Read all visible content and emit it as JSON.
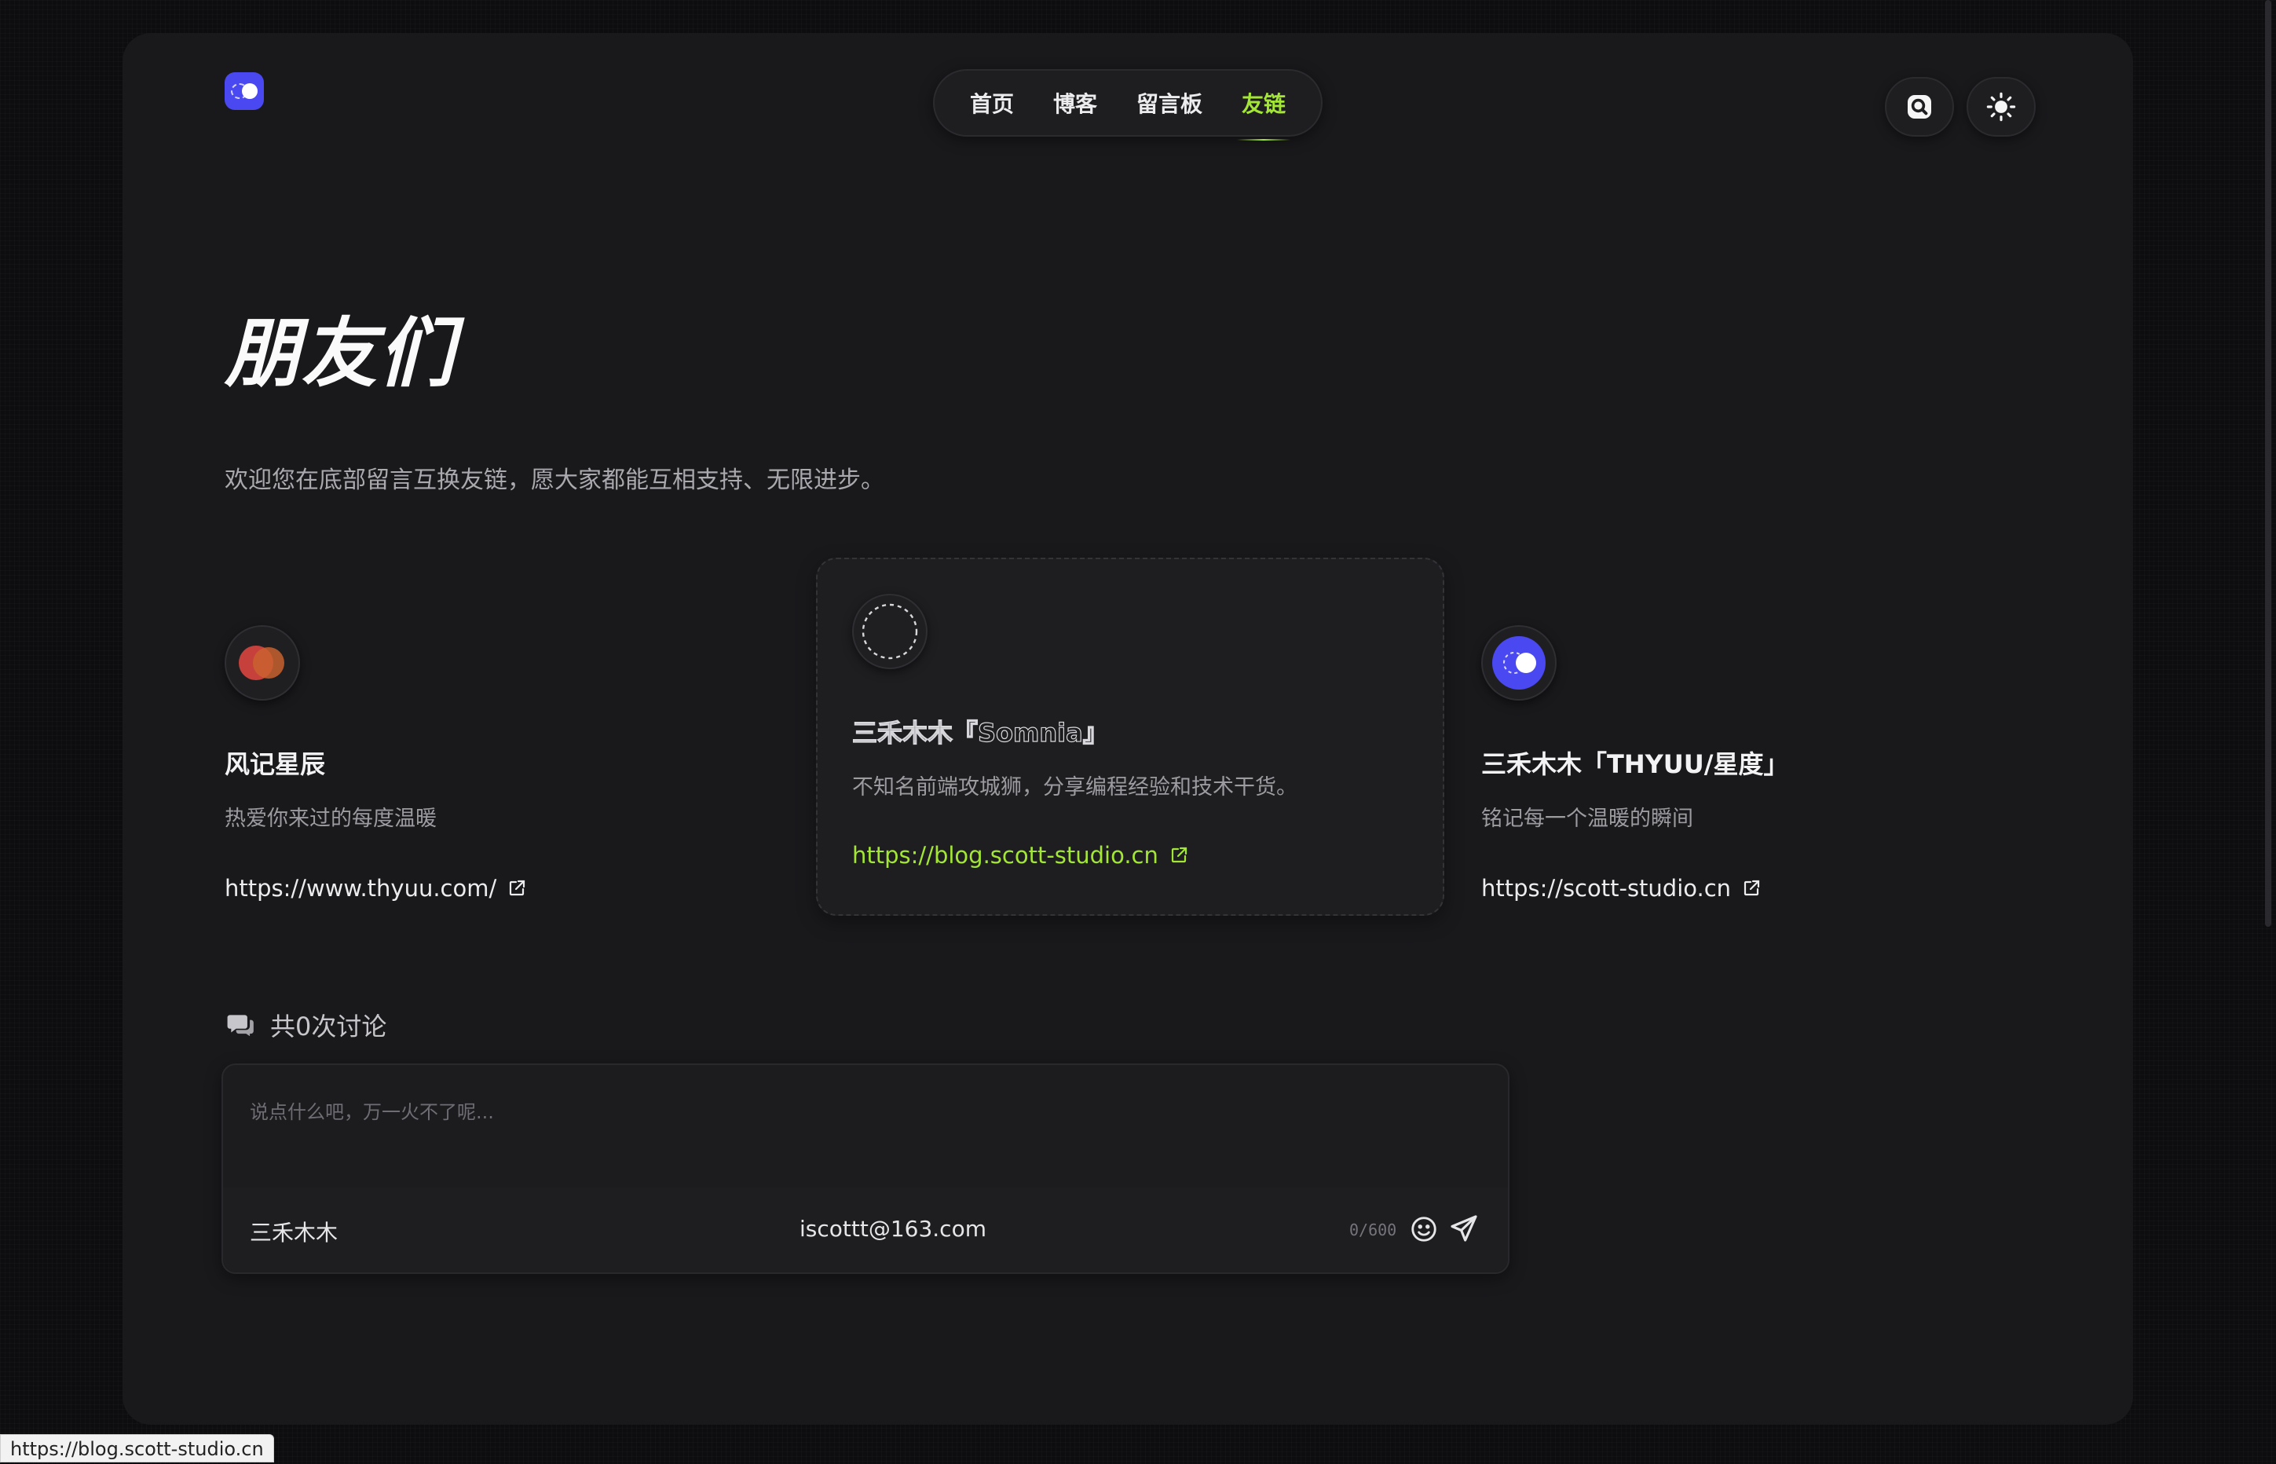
{
  "nav": {
    "items": [
      {
        "label": "首页",
        "active": false
      },
      {
        "label": "博客",
        "active": false
      },
      {
        "label": "留言板",
        "active": false
      },
      {
        "label": "友链",
        "active": true
      }
    ]
  },
  "header": {
    "search_icon": "search-icon",
    "theme_icon": "sun-icon"
  },
  "page": {
    "title": "朋友们",
    "description": "欢迎您在底部留言互换友链，愿大家都能互相支持、无限进步。"
  },
  "friends": [
    {
      "name": "风记星辰",
      "desc": "热爱你来过的每度温暖",
      "url": "https://www.thyuu.com/"
    },
    {
      "name": "三禾木木『Somnia』",
      "desc": "不知名前端攻城狮，分享编程经验和技术干货。",
      "url": "https://blog.scott-studio.cn"
    },
    {
      "name": "三禾木木「THYUU/星度」",
      "desc": "铭记每一个温暖的瞬间",
      "url": "https://scott-studio.cn"
    }
  ],
  "comments": {
    "count_label": "共0次讨论",
    "placeholder": "说点什么吧，万一火不了呢...",
    "username": "三禾木木",
    "email": "iscottt@163.com",
    "char_count": "0/600"
  },
  "status_bar": {
    "url": "https://blog.scott-studio.cn"
  },
  "colors": {
    "accent": "#a3e635",
    "brand": "#4a48f0",
    "panel": "#19191c"
  }
}
